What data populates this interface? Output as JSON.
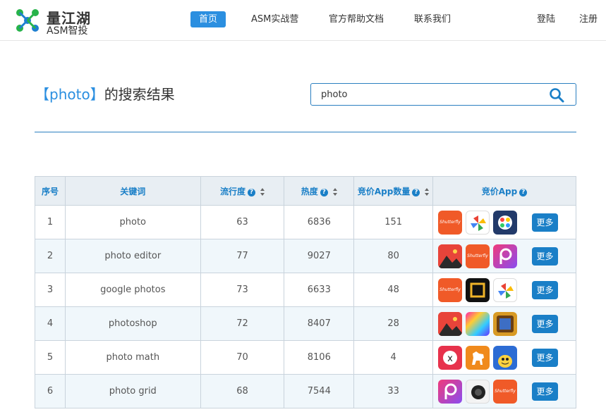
{
  "brand": {
    "name_cn": "量江湖",
    "name_en": "ASM智投"
  },
  "nav": {
    "home": "首页",
    "camp": "ASM实战营",
    "docs": "官方帮助文档",
    "contact": "联系我们",
    "login": "登陆",
    "register": "注册"
  },
  "search": {
    "keyword": "photo",
    "title_open": "【",
    "title_close": "】",
    "title_suffix": "的搜索结果",
    "input_value": "photo"
  },
  "table": {
    "headers": [
      "序号",
      "关键词",
      "流行度",
      "热度",
      "竞价App数量",
      "竞价App"
    ],
    "help_glyph": "?",
    "more_label": "更多",
    "rows": [
      {
        "idx": "1",
        "keyword": "photo",
        "popularity": "63",
        "heat": "6836",
        "bid_count": "151",
        "apps": [
          "Shutterfly",
          "Google Photos",
          "Color wheel app"
        ]
      },
      {
        "idx": "2",
        "keyword": "photo editor",
        "popularity": "77",
        "heat": "9027",
        "bid_count": "80",
        "apps": [
          "Landscape photo app",
          "Shutterfly",
          "PicsArt"
        ]
      },
      {
        "idx": "3",
        "keyword": "google photos",
        "popularity": "73",
        "heat": "6633",
        "bid_count": "48",
        "apps": [
          "Shutterfly",
          "Frame app",
          "Google Photos"
        ]
      },
      {
        "idx": "4",
        "keyword": "photoshop",
        "popularity": "72",
        "heat": "8407",
        "bid_count": "28",
        "apps": [
          "Landscape photo app",
          "Rainbow editor",
          "Gold frame app"
        ]
      },
      {
        "idx": "5",
        "keyword": "photo math",
        "popularity": "70",
        "heat": "8106",
        "bid_count": "4",
        "apps": [
          "X app",
          "Horse app",
          "Monster app"
        ]
      },
      {
        "idx": "6",
        "keyword": "photo grid",
        "popularity": "68",
        "heat": "7544",
        "bid_count": "33",
        "apps": [
          "PicsArt",
          "Camera app",
          "Shutterfly"
        ]
      }
    ]
  },
  "icons": {
    "shutterfly_label": "Shutterfly"
  },
  "colors": {
    "accent": "#2b8fe0",
    "table_header_text": "#1a7fc7",
    "more_button": "#1a7fc7"
  }
}
